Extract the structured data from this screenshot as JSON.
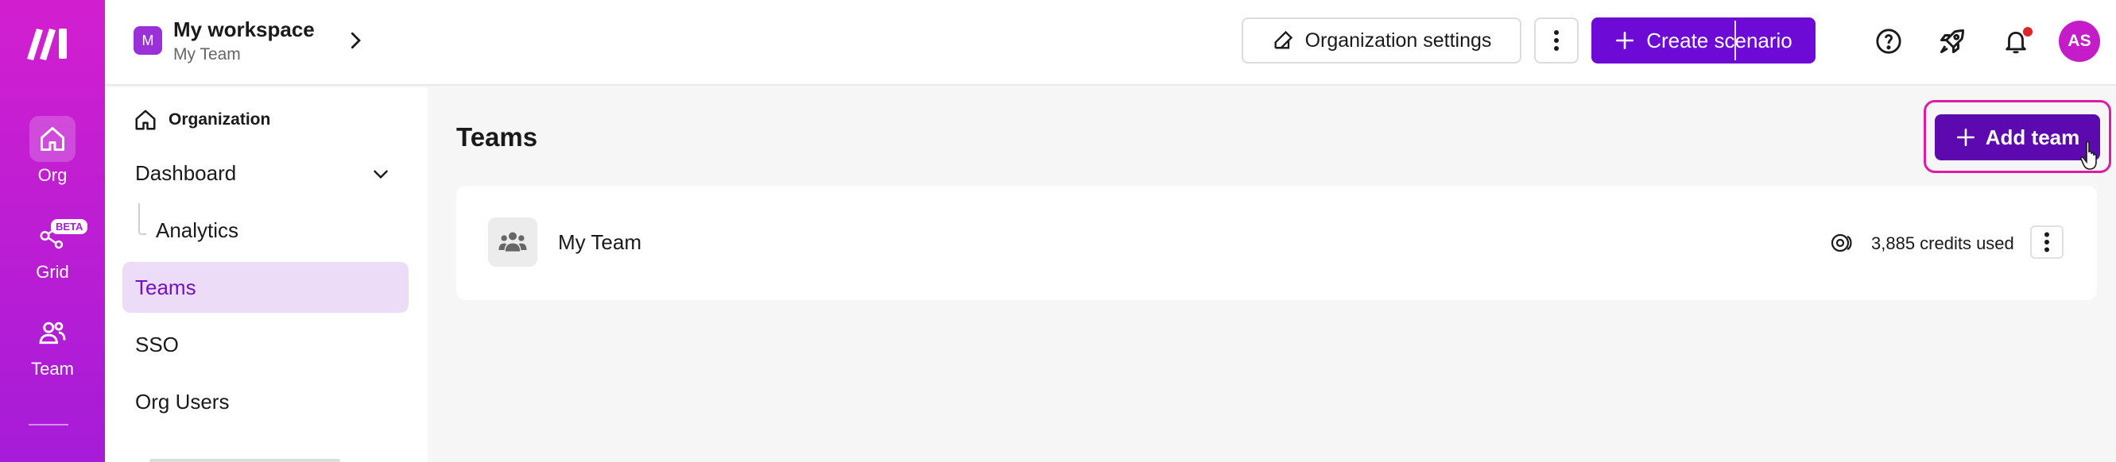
{
  "rail": {
    "items": [
      {
        "label": "Org",
        "icon": "home-icon"
      },
      {
        "label": "Grid",
        "icon": "grid-network-icon",
        "badge": "BETA"
      },
      {
        "label": "Team",
        "icon": "team-icon"
      }
    ]
  },
  "topbar": {
    "workspace_initial": "M",
    "workspace_name": "My workspace",
    "team_name": "My Team",
    "org_settings_label": "Organization settings",
    "create_scenario_label": "Create scenario",
    "avatar_initials": "AS"
  },
  "sidenav": {
    "heading": "Organization",
    "items": [
      {
        "label": "Dashboard"
      },
      {
        "label": "Analytics"
      },
      {
        "label": "Teams"
      },
      {
        "label": "SSO"
      },
      {
        "label": "Org Users"
      }
    ]
  },
  "main": {
    "title": "Teams",
    "add_team_label": "Add team",
    "teams": [
      {
        "name": "My Team",
        "credits": "3,885 credits used"
      }
    ]
  },
  "colors": {
    "brand_gradient_top": "#d21fcf",
    "brand_gradient_bottom": "#a61cd8",
    "primary_button": "#6e0ad6",
    "active_nav_bg": "#ecdcf8",
    "active_nav_text": "#7211c4",
    "highlight_ring": "#e11aa6"
  }
}
